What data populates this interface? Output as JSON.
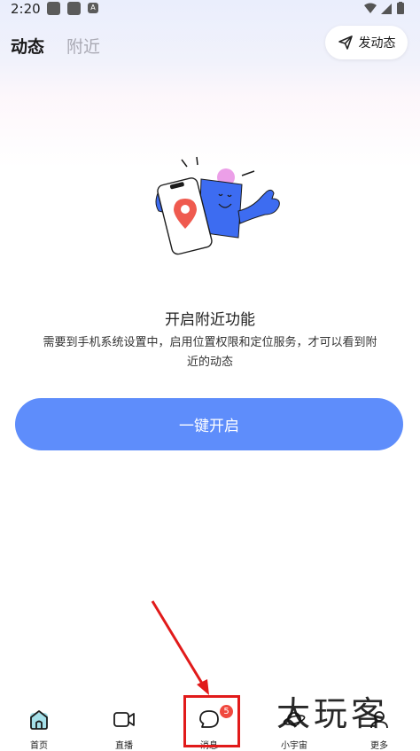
{
  "status_bar": {
    "time": "2:20",
    "app_icon_text": "A"
  },
  "header": {
    "tab_active": "动态",
    "tab_inactive": "附近",
    "post_button_label": "发动态"
  },
  "empty_state": {
    "title": "开启附近功能",
    "description": "需要到手机系统设置中，启用位置权限和定位服务，才可以看到附近的动态",
    "button_label": "一键开启"
  },
  "bottom_nav": {
    "items": [
      {
        "label": "首页",
        "icon": "home-icon"
      },
      {
        "label": "直播",
        "icon": "video-camera-icon"
      },
      {
        "label": "消息",
        "icon": "chat-bubble-icon",
        "badge": "5"
      },
      {
        "label": "小宇宙",
        "icon": "planet-icon"
      },
      {
        "label": "更多",
        "icon": "profile-icon"
      }
    ]
  },
  "watermark": "太玩客",
  "colors": {
    "primary": "#5e8dfb",
    "badge": "#f0483e",
    "annotation": "#e11a1a",
    "illustration_blue": "#3d6cf1",
    "illustration_pin": "#ef5a4f"
  }
}
